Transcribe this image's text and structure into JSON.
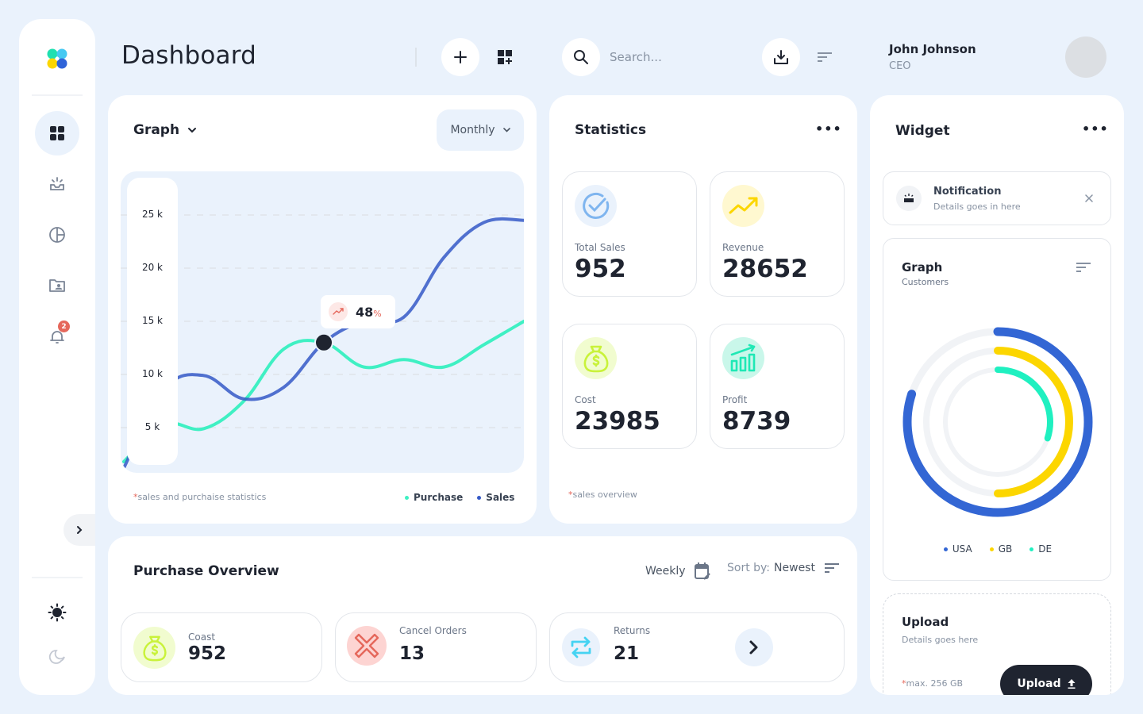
{
  "app": {
    "title": "Dashboard"
  },
  "sidebar": {
    "items": [
      {
        "name": "dashboard",
        "icon": "grid-icon",
        "active": true
      },
      {
        "name": "inbox",
        "icon": "inbox-icon",
        "active": false
      },
      {
        "name": "analytics",
        "icon": "pie-chart-icon",
        "active": false
      },
      {
        "name": "contacts",
        "icon": "folder-user-icon",
        "active": false
      },
      {
        "name": "notifications",
        "icon": "bell-icon",
        "active": false,
        "badge": "2"
      }
    ],
    "theme_light_icon": "sun-icon",
    "theme_dark_icon": "moon-icon",
    "expand_icon": "chevron-right-icon"
  },
  "header": {
    "search_placeholder": "Search...",
    "user_name": "John Johnson",
    "user_role": "CEO"
  },
  "graph_card": {
    "title": "Graph",
    "period_select": "Monthly",
    "tooltip_value": "48",
    "tooltip_unit": "%",
    "footnote_asterisk": "*",
    "footnote": "sales and purchaise statistics"
  },
  "statistics": {
    "title": "Statistics",
    "tiles": [
      {
        "label": "Total Sales",
        "value": "952",
        "icon": "check-circle-icon",
        "color": "#7fb5ef",
        "bg": "#eaf2fc"
      },
      {
        "label": "Revenue",
        "value": "28652",
        "icon": "trending-up-icon",
        "color": "#fcd600",
        "bg": "#fff8d0"
      },
      {
        "label": "Cost",
        "value": "23985",
        "icon": "money-bag-icon",
        "color": "#c9f23a",
        "bg": "#f1fccf"
      },
      {
        "label": "Profit",
        "value": "8739",
        "icon": "bar-chart-growth-icon",
        "color": "#1fe8b5",
        "bg": "#c9f7ea"
      }
    ],
    "footnote_asterisk": "*",
    "footnote": "sales overview"
  },
  "widget": {
    "title": "Widget",
    "notification": {
      "title": "Notification",
      "description": "Details goes in here"
    },
    "customers_graph": {
      "title": "Graph",
      "subtitle": "Customers"
    },
    "upload": {
      "title": "Upload",
      "description": "Details goes here",
      "max_asterisk": "*",
      "max_label": "max. 256 GB",
      "button_label": "Upload"
    }
  },
  "purchase_overview": {
    "title": "Purchase Overview",
    "period": "Weekly",
    "sort_label": "Sort by:",
    "sort_value": "Newest",
    "tiles": [
      {
        "label": "Coast",
        "value": "952",
        "icon": "money-bag-icon"
      },
      {
        "label": "Cancel Orders",
        "value": "13",
        "icon": "cancel-x-icon"
      },
      {
        "label": "Returns",
        "value": "21",
        "icon": "swap-arrows-icon"
      }
    ]
  },
  "chart_data": [
    {
      "type": "line",
      "title": "Graph",
      "xlabel": "",
      "ylabel": "",
      "ylim": [
        0,
        27000
      ],
      "y_ticks": [
        "5 k",
        "10 k",
        "15 k",
        "20 k",
        "25 k"
      ],
      "y_tick_values": [
        5000,
        10000,
        15000,
        20000,
        25000
      ],
      "grid": true,
      "legend": "bottom-right",
      "x": [
        0,
        1,
        2,
        3,
        4,
        5,
        6,
        7,
        8,
        9,
        10
      ],
      "series": [
        {
          "name": "Purchase",
          "color": "#3ff0c3",
          "values": [
            1800,
            5300,
            4900,
            7500,
            12400,
            13000,
            10700,
            11400,
            10700,
            12800,
            15000
          ]
        },
        {
          "name": "Sales",
          "color": "#3559c7",
          "values": [
            1200,
            8600,
            9900,
            7700,
            8800,
            13000,
            15000,
            15400,
            21000,
            24300,
            24500
          ]
        }
      ],
      "highlight": {
        "x": 5,
        "label": "48%"
      }
    },
    {
      "type": "radial-bar",
      "title": "Graph",
      "subtitle": "Customers",
      "legend": "bottom",
      "categories": [
        "USA",
        "GB",
        "DE"
      ],
      "values": [
        80,
        50,
        30
      ],
      "unit": "percent",
      "colors": [
        "#3366d4",
        "#fcd600",
        "#1ff0c0"
      ]
    }
  ]
}
